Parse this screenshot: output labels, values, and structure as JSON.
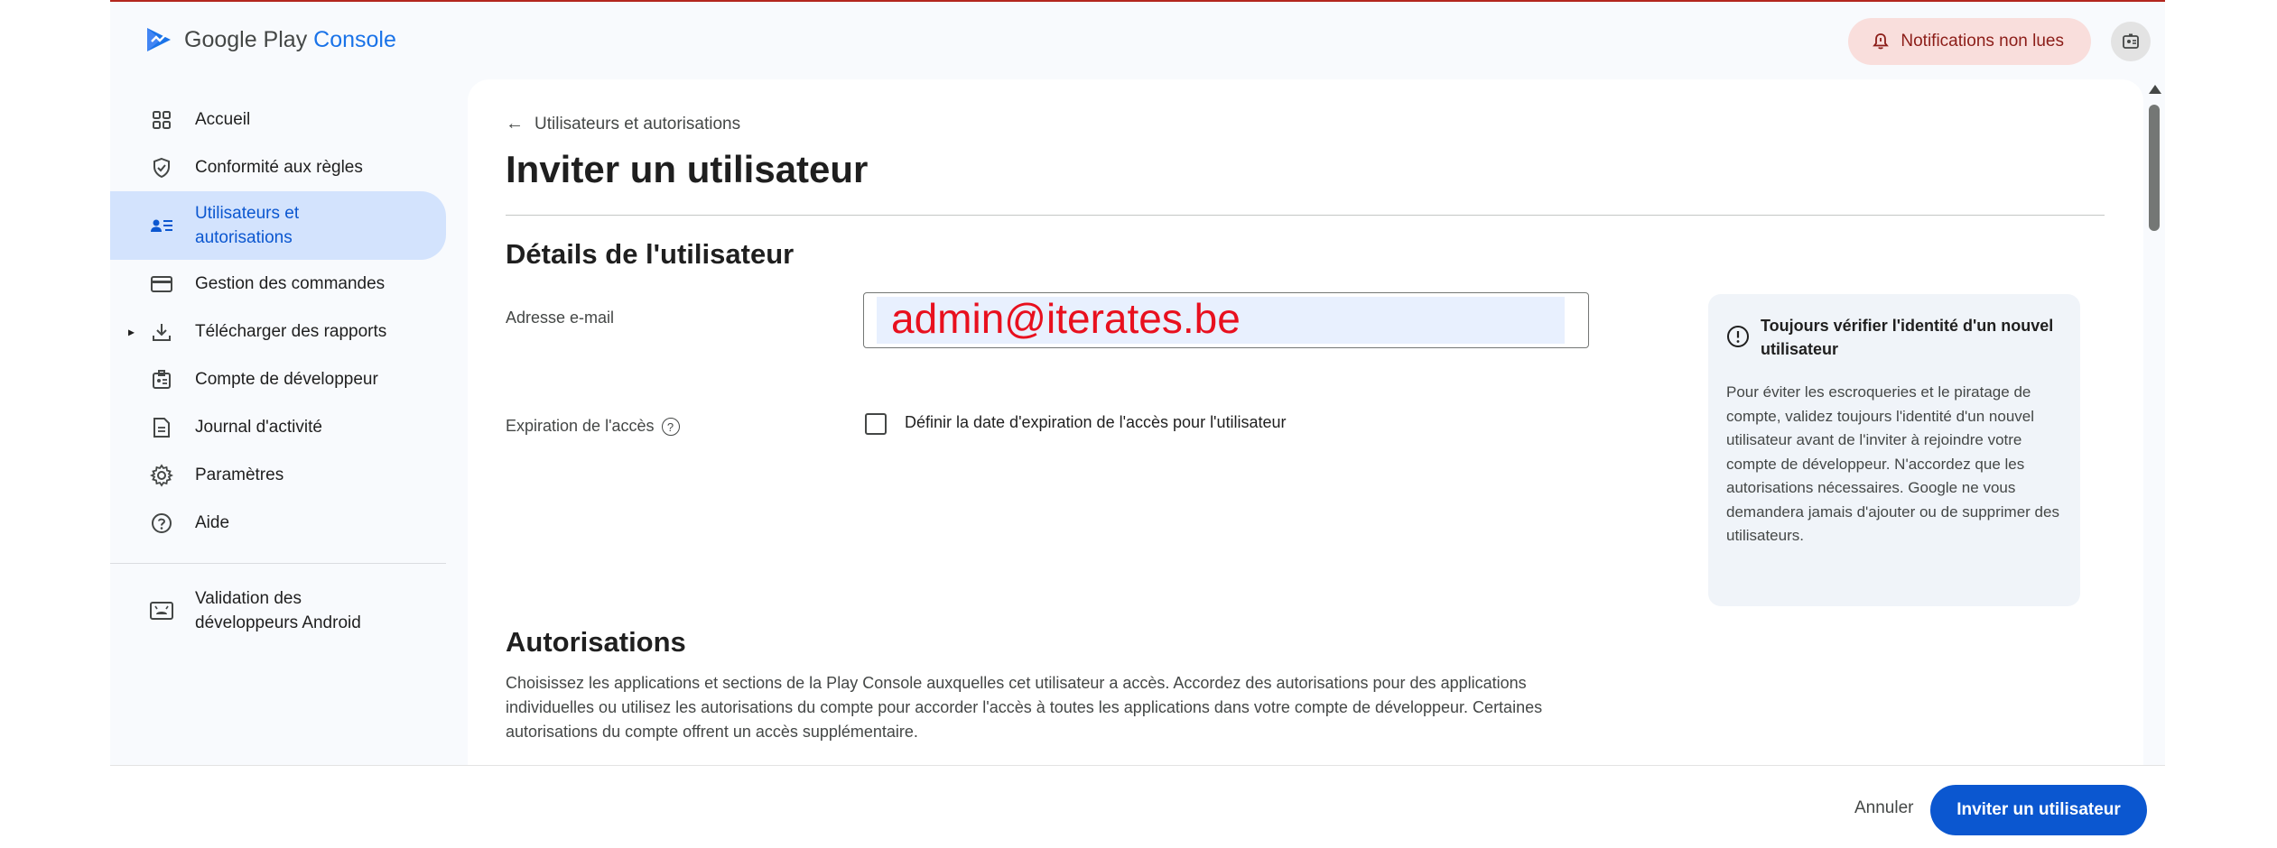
{
  "colors": {
    "accent": "#0b57d0",
    "active_nav_bg": "#d3e3fd",
    "notif_bg": "#f9dedc",
    "email_text": "#e8101e"
  },
  "header": {
    "logo_text_main": "Google Play",
    "logo_text_accent": "Console",
    "notifications_label": "Notifications non lues"
  },
  "sidebar": {
    "items": [
      {
        "label": "Accueil",
        "icon": "dashboard-icon"
      },
      {
        "label": "Conformité aux règles",
        "icon": "shield-check-icon"
      },
      {
        "label": "Utilisateurs et autorisations",
        "icon": "users-list-icon",
        "active": true
      },
      {
        "label": "Gestion des commandes",
        "icon": "credit-card-icon"
      },
      {
        "label": "Télécharger des rapports",
        "icon": "download-icon"
      },
      {
        "label": "Compte de développeur",
        "icon": "id-badge-icon"
      },
      {
        "label": "Journal d'activité",
        "icon": "document-icon"
      },
      {
        "label": "Paramètres",
        "icon": "gear-icon"
      },
      {
        "label": "Aide",
        "icon": "help-icon"
      }
    ],
    "bottom_item": {
      "label": "Validation des développeurs Android",
      "icon": "android-card-icon"
    }
  },
  "main": {
    "breadcrumb": "Utilisateurs et autorisations",
    "title": "Inviter un utilisateur",
    "details_heading": "Détails de l'utilisateur",
    "email_label": "Adresse e-mail",
    "email_value": "admin@iterates.be",
    "expiration_label": "Expiration de l'accès",
    "expiration_help": "?",
    "expiration_checkbox_label": "Définir la date d'expiration de l'accès pour l'utilisateur",
    "info_card": {
      "title": "Toujours vérifier l'identité d'un nouvel utilisateur",
      "body": "Pour éviter les escroqueries et le piratage de compte, validez toujours l'identité d'un nouvel utilisateur avant de l'inviter à rejoindre votre compte de développeur. N'accordez que les autorisations nécessaires. Google ne vous demandera jamais d'ajouter ou de supprimer des utilisateurs."
    },
    "permissions_heading": "Autorisations",
    "permissions_desc": "Choisissez les applications et sections de la Play Console auxquelles cet utilisateur a accès. Accordez des autorisations pour des applications individuelles ou utilisez les autorisations du compte pour accorder l'accès à toutes les applications dans votre compte de développeur. Certaines autorisations du compte offrent un accès supplémentaire."
  },
  "footer": {
    "cancel_label": "Annuler",
    "invite_label": "Inviter un utilisateur"
  }
}
